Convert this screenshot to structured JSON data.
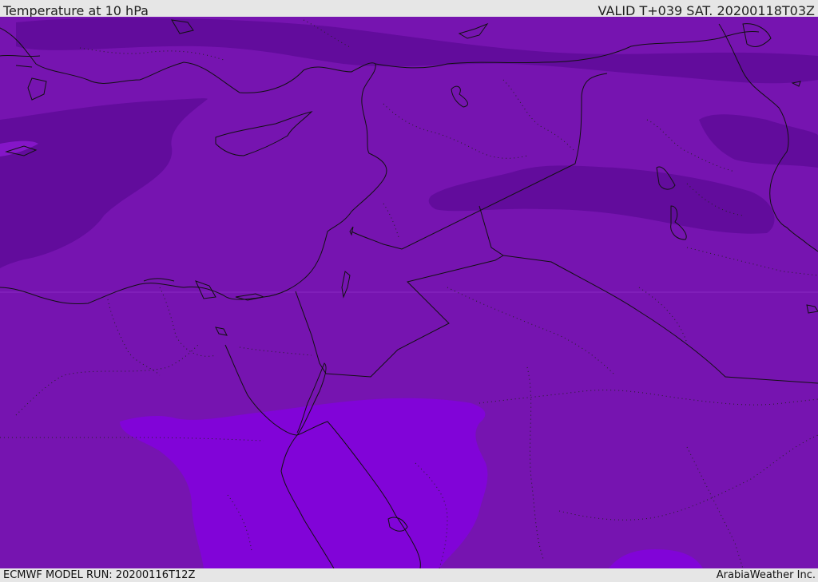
{
  "header": {
    "title": "Temperature at 10 hPa",
    "valid": "VALID T+039 SAT. 20200118T03Z"
  },
  "footer": {
    "model_run": "ECMWF MODEL RUN: 20200116T12Z",
    "credit": "ArabiaWeather Inc."
  },
  "colors": {
    "base_field": "#7614b0",
    "cold_band": "#620c9c",
    "warm_region": "#8104d8",
    "boundaries": "#111111"
  }
}
